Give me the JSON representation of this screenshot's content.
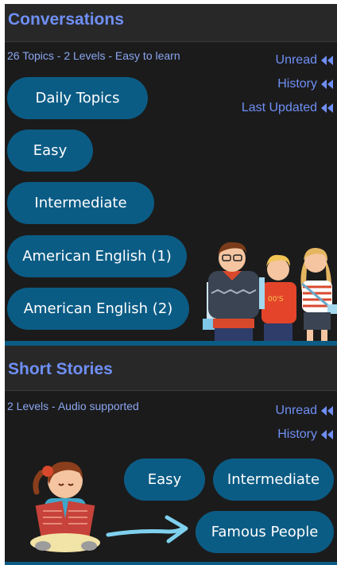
{
  "conversations": {
    "title": "Conversations",
    "subtitle": "26 Topics - 2 Levels - Easy to learn",
    "links": [
      "Unread",
      "History",
      "Last Updated"
    ],
    "buttons": [
      "Daily Topics",
      "Easy",
      "Intermediate",
      "American English (1)",
      "American English (2)"
    ]
  },
  "stories": {
    "title": "Short Stories",
    "subtitle": "2 Levels - Audio supported",
    "links": [
      "Unread",
      "History"
    ],
    "buttons": [
      "Easy",
      "Intermediate",
      "Famous People"
    ]
  },
  "icons": {
    "link_arrow": "double-chevron-left-icon",
    "people_illustration": "students-illustration",
    "reader_illustration": "girl-reading-illustration",
    "pointer": "curved-arrow-icon"
  },
  "colors": {
    "accent": "#6f8ff5",
    "button": "#0b5c85",
    "background": "#1b1b1b",
    "header": "#282828"
  }
}
